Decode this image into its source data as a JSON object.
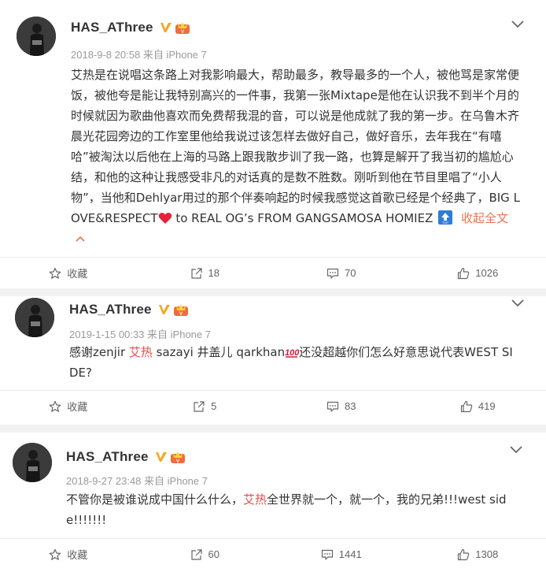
{
  "posts": [
    {
      "username": "HAS_AThree",
      "time": "2018-9-8 20:58",
      "via": "来自 iPhone 7",
      "text_parts": [
        "艾热是在说唱这条路上对我影响最大，帮助最多，教导最多的一个人，被他骂是家常便饭，被他夸是能让我特别高兴的一件事，我第一张Mixtape是他在认识我不到半个月的时候就因为歌曲他喜欢而免费帮我混的音，可以说是他成就了我的第一步。在乌鲁木齐晨光花园旁边的工作室里他给我说过该怎样去做好自己，做好音乐，去年我在“有嘻哈”被淘汰以后他在上海的马路上跟我散步训了我一路，也算是解开了我当初的尴尬心结，和他的这种让我感受非凡的对话真的是数不胜数。刚听到他在节目里唱了“小人物”，当他和Dehlyar用过的那个伴奏响起的时候我感觉这首歌已经是个经典了，BIG LOVE&RESPECT",
        " to REAL OG’s FROM GANGSAMOSA HOMIEZ"
      ],
      "collapse_label": "收起全文",
      "favorite_label": "收藏",
      "repost_count": "18",
      "comment_count": "70",
      "like_count": "1026"
    },
    {
      "username": "HAS_AThree",
      "time": "2019-1-15 00:33",
      "via": "来自 iPhone 7",
      "text_before": "感谢zenjir ",
      "mention": "艾热",
      "text_after": " sazayi 井盖儿 qarkhan",
      "text_end": "还没超越你们怎么好意思说代表WEST SIDE?",
      "favorite_label": "收藏",
      "repost_count": "5",
      "comment_count": "83",
      "like_count": "419"
    },
    {
      "username": "HAS_AThree",
      "time": "2018-9-27 23:48",
      "via": "来自 iPhone 7",
      "text_before": "不管你是被谁说成中国什么什么，",
      "mention": "艾热",
      "text_after": "全世界就一个，就一个，我的兄弟!!!west side!!!!!!!",
      "favorite_label": "收藏",
      "repost_count": "60",
      "comment_count": "1441",
      "like_count": "1308"
    }
  ],
  "colors": {
    "accent": "#eb7350",
    "mention": "#eb4c4c",
    "meta": "#9a9a9a",
    "vip_gold": "#f5a623"
  }
}
